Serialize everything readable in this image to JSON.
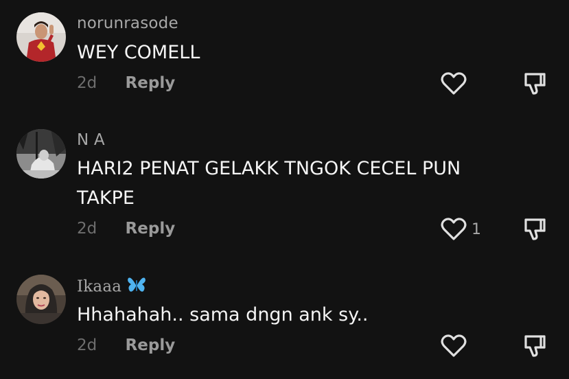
{
  "comments": [
    {
      "username": "norunrasode",
      "text": "WEY COMELL",
      "time": "2d",
      "reply_label": "Reply",
      "likes": "",
      "avatar": "superhero-avatar"
    },
    {
      "username": "N A",
      "text": "HARI2 PENAT GELAKK TNGOK CECEL PUN TAKPE",
      "time": "2d",
      "reply_label": "Reply",
      "likes": "1",
      "avatar": "bw-photo-avatar"
    },
    {
      "username": "Ikaaa",
      "username_emoji": "butterfly-icon",
      "text": "Hhahahah.. sama dngn ank sy..",
      "time": "2d",
      "reply_label": "Reply",
      "likes": "",
      "avatar": "hijab-avatar"
    }
  ],
  "colors": {
    "background": "#121212",
    "username": "#a8a8a8",
    "text": "#f5f5f5",
    "time": "#6e6e6e",
    "reply": "#9a9a9a",
    "icon": "#e0e0e0",
    "butterfly": "#4fb3f0"
  }
}
